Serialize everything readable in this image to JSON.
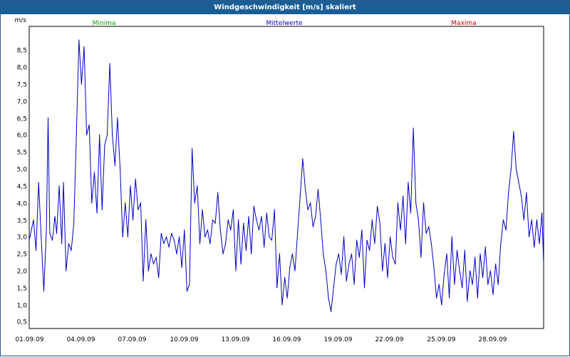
{
  "window": {
    "title": "Windgeschwindigkeit [m/s] skaliert"
  },
  "legend": [
    {
      "label": "Minima",
      "color": "#00a000"
    },
    {
      "label": "Mittelwerte",
      "color": "#0000c0"
    },
    {
      "label": "Maxima",
      "color": "#c00000"
    }
  ],
  "colors": {
    "titlebar": "#1b5e95",
    "line": "#0000c0",
    "grid": "#000000"
  },
  "chart_data": {
    "type": "line",
    "title": "Windgeschwindigkeit [m/s] skaliert",
    "ylabel": "m/s",
    "xlabel": "",
    "ylim": [
      0.3,
      9.2
    ],
    "y_ticks": [
      "0,5",
      "1,0",
      "1,5",
      "2,0",
      "2,5",
      "3,0",
      "3,5",
      "4,0",
      "4,5",
      "5,0",
      "5,5",
      "6,0",
      "6,5",
      "7,0",
      "7,5",
      "8,0",
      "8,5"
    ],
    "x_ticks": [
      "01.09.09",
      "04.09.09",
      "07.09.09",
      "10.09.09",
      "13.09.09",
      "16.09.09",
      "19.09.09",
      "22.09.09",
      "25.09.09",
      "28.09.09"
    ],
    "x_range_days": [
      0,
      30
    ],
    "grid": true,
    "series": [
      {
        "name": "Mittelwerte",
        "x": [
          0.0,
          0.25,
          0.4,
          0.55,
          0.7,
          0.85,
          1.0,
          1.1,
          1.2,
          1.35,
          1.5,
          1.6,
          1.75,
          1.9,
          2.0,
          2.15,
          2.3,
          2.45,
          2.6,
          2.75,
          2.9,
          3.05,
          3.2,
          3.35,
          3.5,
          3.65,
          3.8,
          3.95,
          4.1,
          4.25,
          4.4,
          4.55,
          4.7,
          4.85,
          5.0,
          5.15,
          5.3,
          5.45,
          5.6,
          5.75,
          5.9,
          6.05,
          6.2,
          6.35,
          6.5,
          6.65,
          6.8,
          6.95,
          7.1,
          7.25,
          7.4,
          7.55,
          7.7,
          7.85,
          8.0,
          8.15,
          8.3,
          8.45,
          8.6,
          8.75,
          8.9,
          9.05,
          9.2,
          9.35,
          9.5,
          9.65,
          9.8,
          9.95,
          10.1,
          10.25,
          10.4,
          10.55,
          10.7,
          10.85,
          11.0,
          11.15,
          11.3,
          11.45,
          11.6,
          11.75,
          11.9,
          12.05,
          12.2,
          12.35,
          12.5,
          12.65,
          12.8,
          12.95,
          13.1,
          13.25,
          13.4,
          13.55,
          13.7,
          13.85,
          14.0,
          14.15,
          14.3,
          14.45,
          14.6,
          14.75,
          14.9,
          15.05,
          15.2,
          15.35,
          15.5,
          15.65,
          15.8,
          15.95,
          16.1,
          16.25,
          16.4,
          16.55,
          16.7,
          16.85,
          17.0,
          17.15,
          17.3,
          17.45,
          17.6,
          17.75,
          17.9,
          18.05,
          18.2,
          18.35,
          18.5,
          18.65,
          18.8,
          18.95,
          19.1,
          19.25,
          19.4,
          19.55,
          19.7,
          19.85,
          20.0,
          20.15,
          20.3,
          20.45,
          20.6,
          20.75,
          20.9,
          21.05,
          21.2,
          21.35,
          21.5,
          21.65,
          21.8,
          21.95,
          22.1,
          22.25,
          22.4,
          22.55,
          22.7,
          22.85,
          23.0,
          23.15,
          23.3,
          23.45,
          23.6,
          23.75,
          23.9,
          24.05,
          24.2,
          24.35,
          24.5,
          24.65,
          24.8,
          24.95,
          25.1,
          25.25,
          25.4,
          25.55,
          25.7,
          25.85,
          26.0,
          26.15,
          26.3,
          26.45,
          26.6,
          26.75,
          26.9,
          27.05,
          27.2,
          27.35,
          27.5,
          27.65,
          27.8,
          27.95,
          28.1,
          28.25,
          28.4,
          28.55,
          28.7,
          28.85,
          29.0,
          29.15,
          29.3,
          29.45,
          29.6,
          29.75,
          29.9,
          30.0
        ],
        "values": [
          2.9,
          3.5,
          2.6,
          4.6,
          3.0,
          1.4,
          3.2,
          6.5,
          3.1,
          2.9,
          3.6,
          3.1,
          4.5,
          2.8,
          4.6,
          2.0,
          2.8,
          2.6,
          3.4,
          6.0,
          8.8,
          7.5,
          8.6,
          6.0,
          6.3,
          4.0,
          4.9,
          3.7,
          6.0,
          3.8,
          5.7,
          6.0,
          8.1,
          6.0,
          5.1,
          6.5,
          5.0,
          3.0,
          4.0,
          3.0,
          4.5,
          3.5,
          4.7,
          3.8,
          4.0,
          1.7,
          3.5,
          2.0,
          2.5,
          2.2,
          2.4,
          1.8,
          3.1,
          2.8,
          3.0,
          2.7,
          3.1,
          2.9,
          2.5,
          3.0,
          2.1,
          3.2,
          1.4,
          1.6,
          5.6,
          4.0,
          4.5,
          2.8,
          3.8,
          3.0,
          3.2,
          2.8,
          3.5,
          3.4,
          4.3,
          3.2,
          2.5,
          2.8,
          3.5,
          3.2,
          3.8,
          2.0,
          3.5,
          2.2,
          3.4,
          2.6,
          3.6,
          2.5,
          3.9,
          3.5,
          3.2,
          3.6,
          2.7,
          3.7,
          3.0,
          2.9,
          3.8,
          1.5,
          2.5,
          1.0,
          1.8,
          1.2,
          2.1,
          2.5,
          2.0,
          3.1,
          4.2,
          5.3,
          4.4,
          3.8,
          4.0,
          3.3,
          3.6,
          4.4,
          3.5,
          2.5,
          2.0,
          1.2,
          0.8,
          1.5,
          2.2,
          2.5,
          1.9,
          3.0,
          1.7,
          2.2,
          2.5,
          1.6,
          2.9,
          2.4,
          3.2,
          1.5,
          2.9,
          2.6,
          3.5,
          2.8,
          3.9,
          3.4,
          2.0,
          2.8,
          1.8,
          3.0,
          2.4,
          2.2,
          4.0,
          3.2,
          4.2,
          2.8,
          4.6,
          3.7,
          6.2,
          4.0,
          3.5,
          2.4,
          4.0,
          3.1,
          3.3,
          2.8,
          2.1,
          1.2,
          1.6,
          1.0,
          1.9,
          2.5,
          1.2,
          3.0,
          1.6,
          2.6,
          2.0,
          1.5,
          2.6,
          1.1,
          2.0,
          1.6,
          2.4,
          1.2,
          2.5,
          1.8,
          2.7,
          1.6,
          2.0,
          1.3,
          2.2,
          1.6,
          2.8,
          3.5,
          3.2,
          4.3,
          5.0,
          6.1,
          5.0,
          4.6,
          4.2,
          3.5,
          4.3,
          3.0,
          3.5,
          2.7,
          3.5,
          2.8,
          3.7,
          2.2
        ]
      }
    ]
  }
}
